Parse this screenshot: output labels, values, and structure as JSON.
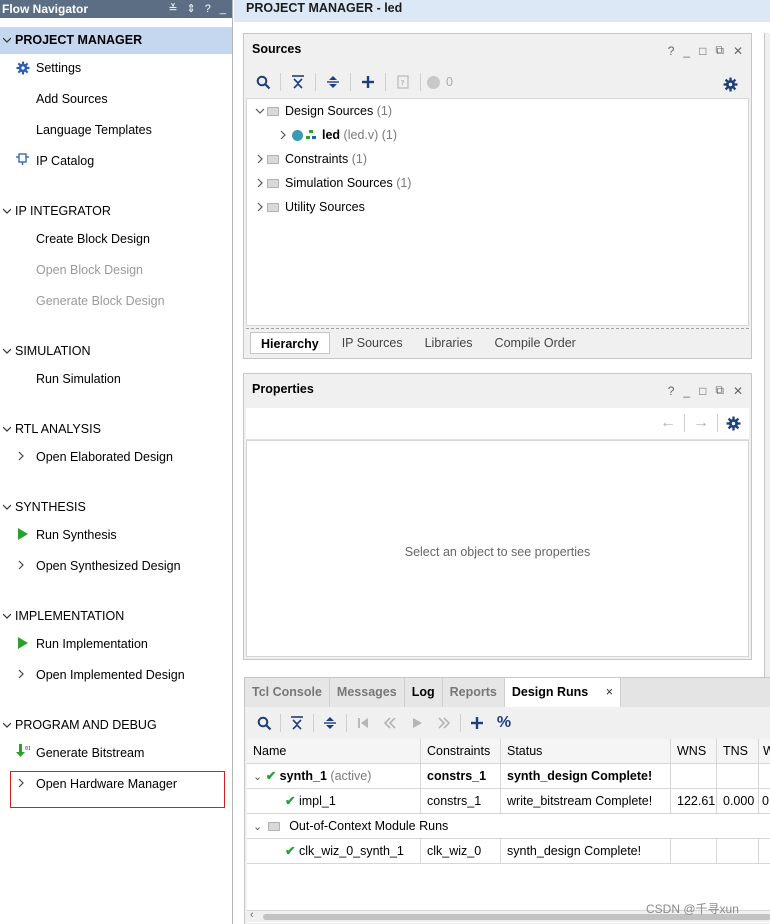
{
  "flow_navigator": {
    "title": "Flow Navigator",
    "toolbar": [
      "≚",
      "⇕",
      "?",
      "_"
    ],
    "sections": {
      "project_manager": {
        "label": "PROJECT MANAGER",
        "settings": "Settings",
        "add_sources": "Add Sources",
        "language_templates": "Language Templates",
        "ip_catalog": "IP Catalog"
      },
      "ip_integrator": {
        "label": "IP INTEGRATOR",
        "create_block": "Create Block Design",
        "open_block": "Open Block Design",
        "generate_block": "Generate Block Design"
      },
      "simulation": {
        "label": "SIMULATION",
        "run_sim": "Run Simulation"
      },
      "rtl_analysis": {
        "label": "RTL ANALYSIS",
        "open_elab": "Open Elaborated Design"
      },
      "synthesis": {
        "label": "SYNTHESIS",
        "run_synth": "Run Synthesis",
        "open_synth": "Open Synthesized Design"
      },
      "implementation": {
        "label": "IMPLEMENTATION",
        "run_impl": "Run Implementation",
        "open_impl": "Open Implemented Design"
      },
      "program_debug": {
        "label": "PROGRAM AND DEBUG",
        "gen_bit": "Generate Bitstream",
        "open_hw": "Open Hardware Manager"
      }
    }
  },
  "main_header": "PROJECT MANAGER - led",
  "sources": {
    "title": "Sources",
    "ctrl": [
      "?",
      "_",
      "□",
      "⧉",
      "✕"
    ],
    "count_badge": "0",
    "tree": {
      "design_sources": {
        "label": "Design Sources",
        "count": "(1)"
      },
      "led": {
        "label": "led",
        "file": "(led.v) (1)"
      },
      "constraints": {
        "label": "Constraints",
        "count": "(1)"
      },
      "simulation_sources": {
        "label": "Simulation Sources",
        "count": "(1)"
      },
      "utility_sources": {
        "label": "Utility Sources"
      }
    },
    "tabs": [
      "Hierarchy",
      "IP Sources",
      "Libraries",
      "Compile Order"
    ]
  },
  "properties": {
    "title": "Properties",
    "ctrl": [
      "?",
      "_",
      "□",
      "⧉",
      "✕"
    ],
    "empty_message": "Select an object to see properties"
  },
  "bottom_tabs": [
    "Tcl Console",
    "Messages",
    "Log",
    "Reports",
    "Design Runs"
  ],
  "bottom_close": "×",
  "design_runs": {
    "columns": [
      "Name",
      "Constraints",
      "Status",
      "WNS",
      "TNS",
      "W"
    ],
    "rows": [
      {
        "name": "synth_1",
        "suffix": "(active)",
        "constraints": "constrs_1",
        "status": "synth_design Complete!",
        "wns": "",
        "tns": "",
        "w": ""
      },
      {
        "name": "impl_1",
        "suffix": "",
        "constraints": "constrs_1",
        "status": "write_bitstream Complete!",
        "wns": "122.61",
        "tns": "0.000",
        "w": "0"
      },
      {
        "name": "Out-of-Context Module Runs",
        "suffix": "",
        "constraints": "",
        "status": "",
        "wns": "",
        "tns": "",
        "w": ""
      },
      {
        "name": "clk_wiz_0_synth_1",
        "suffix": "",
        "constraints": "clk_wiz_0",
        "status": "synth_design Complete!",
        "wns": "",
        "tns": "",
        "w": ""
      }
    ]
  },
  "watermark": "CSDN @千寻xun",
  "colors": {
    "accent_blue": "#2a5db0",
    "selected_row": "#c5d7ef",
    "green_run": "#2ca02c",
    "check": "#28a038",
    "highlight_box": "#d02020"
  }
}
